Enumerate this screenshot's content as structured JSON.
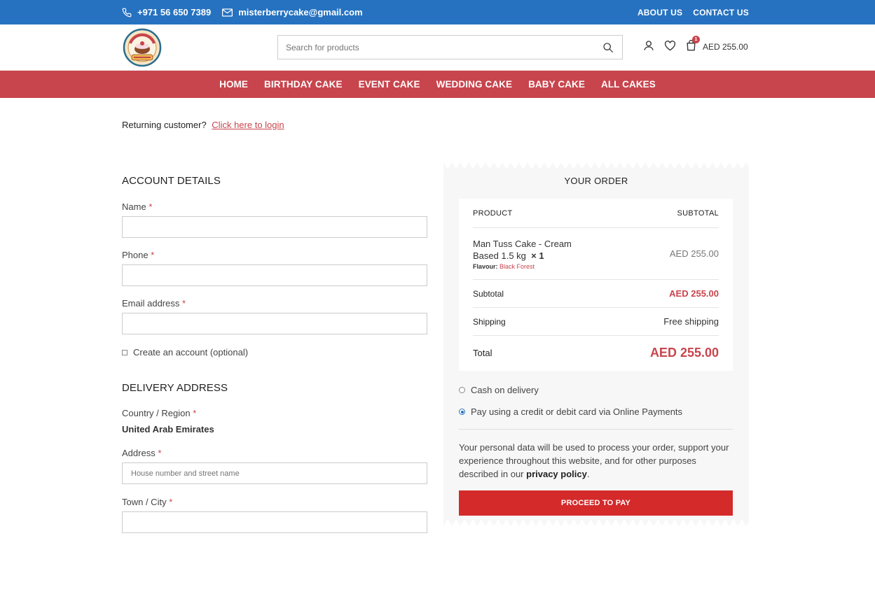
{
  "topbar": {
    "phone": "+971 56 650 7389",
    "email": "misterberrycake@gmail.com",
    "links": [
      "ABOUT US",
      "CONTACT US"
    ],
    "color": "#2672c0"
  },
  "header": {
    "logo_text_top": "LOVE AT FIRST BITE",
    "logo_text_bottom": "Mr. BERRY",
    "search_placeholder": "Search for products",
    "cart_count": "1",
    "cart_total": "AED 255.00"
  },
  "nav": {
    "items": [
      "HOME",
      "BIRTHDAY CAKE",
      "EVENT CAKE",
      "WEDDING CAKE",
      "BABY CAKE",
      "ALL CAKES"
    ],
    "color": "#c8454d"
  },
  "returning": {
    "text": "Returning customer?",
    "link": "Click here to login"
  },
  "account": {
    "title": "ACCOUNT DETAILS",
    "name_label": "Name",
    "phone_label": "Phone",
    "email_label": "Email address",
    "required_mark": "*",
    "create_account_label": "Create an account (optional)"
  },
  "delivery": {
    "title": "DELIVERY ADDRESS",
    "country_label": "Country / Region",
    "country_value": "United Arab Emirates",
    "address_label": "Address",
    "address_placeholder": "House number and street name",
    "city_label": "Town / City"
  },
  "order": {
    "title": "YOUR ORDER",
    "col_product": "PRODUCT",
    "col_subtotal": "SUBTOTAL",
    "item_name_line1": "Man Tuss Cake - Cream",
    "item_name_line2": "Based 1.5 kg",
    "item_qty": "× 1",
    "item_meta_label": "Flavour:",
    "item_meta_value": "Black Forest",
    "item_price": "AED 255.00",
    "subtotal_label": "Subtotal",
    "subtotal_value": "AED 255.00",
    "shipping_label": "Shipping",
    "shipping_value": "Free shipping",
    "total_label": "Total",
    "total_value": "AED 255.00"
  },
  "payment": {
    "options": [
      "Cash on delivery",
      "Pay using a credit or debit card via Online Payments"
    ],
    "selected": "Pay using a credit or debit card via Online Payments",
    "privacy_text": "Your personal data will be used to process your order, support your experience throughout this website, and for other purposes described in our",
    "privacy_link": "privacy policy",
    "privacy_end": ".",
    "button": "PROCEED TO PAY",
    "button_color": "#d42a2a"
  }
}
